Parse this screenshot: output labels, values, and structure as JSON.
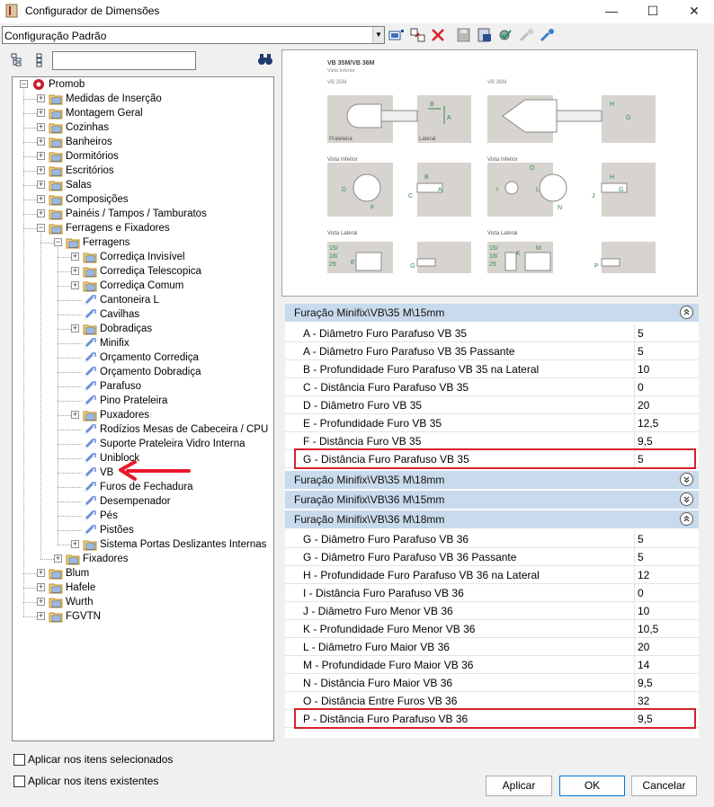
{
  "window": {
    "title": "Configurador de Dimensões",
    "minimize": "—",
    "maximize": "☐",
    "close": "✕"
  },
  "toolbar": {
    "config_value": "Configuração Padrão"
  },
  "tree": {
    "search_value": "",
    "items": [
      {
        "label": "Promob",
        "level": 0,
        "expand": "-",
        "icon": "promob"
      },
      {
        "label": "Medidas de Inserção",
        "level": 1,
        "expand": "+",
        "icon": "folder"
      },
      {
        "label": "Montagem Geral",
        "level": 1,
        "expand": "+",
        "icon": "folder"
      },
      {
        "label": "Cozinhas",
        "level": 1,
        "expand": "+",
        "icon": "folder"
      },
      {
        "label": "Banheiros",
        "level": 1,
        "expand": "+",
        "icon": "folder"
      },
      {
        "label": "Dormitórios",
        "level": 1,
        "expand": "+",
        "icon": "folder"
      },
      {
        "label": "Escritórios",
        "level": 1,
        "expand": "+",
        "icon": "folder"
      },
      {
        "label": "Salas",
        "level": 1,
        "expand": "+",
        "icon": "folder"
      },
      {
        "label": "Composições",
        "level": 1,
        "expand": "+",
        "icon": "folder"
      },
      {
        "label": "Painéis / Tampos / Tamburatos",
        "level": 1,
        "expand": "+",
        "icon": "folder"
      },
      {
        "label": "Ferragens e Fixadores",
        "level": 1,
        "expand": "-",
        "icon": "folder"
      },
      {
        "label": "Ferragens",
        "level": 2,
        "expand": "-",
        "icon": "folder"
      },
      {
        "label": "Corrediça Invisível",
        "level": 3,
        "expand": "+",
        "icon": "folder"
      },
      {
        "label": "Corrediça Telescopica",
        "level": 3,
        "expand": "+",
        "icon": "folder"
      },
      {
        "label": "Corrediça Comum",
        "level": 3,
        "expand": "+",
        "icon": "folder"
      },
      {
        "label": "Cantoneira L",
        "level": 3,
        "expand": "",
        "icon": "tool"
      },
      {
        "label": "Cavilhas",
        "level": 3,
        "expand": "",
        "icon": "tool"
      },
      {
        "label": "Dobradiças",
        "level": 3,
        "expand": "+",
        "icon": "folder"
      },
      {
        "label": "Minifix",
        "level": 3,
        "expand": "",
        "icon": "tool"
      },
      {
        "label": "Orçamento Corrediça",
        "level": 3,
        "expand": "",
        "icon": "tool"
      },
      {
        "label": "Orçamento Dobradiça",
        "level": 3,
        "expand": "",
        "icon": "tool"
      },
      {
        "label": "Parafuso",
        "level": 3,
        "expand": "",
        "icon": "tool"
      },
      {
        "label": "Pino Prateleira",
        "level": 3,
        "expand": "",
        "icon": "tool"
      },
      {
        "label": "Puxadores",
        "level": 3,
        "expand": "+",
        "icon": "folder"
      },
      {
        "label": "Rodízios Mesas de Cabeceira / CPU",
        "level": 3,
        "expand": "",
        "icon": "tool"
      },
      {
        "label": "Suporte Prateleira Vidro Interna",
        "level": 3,
        "expand": "",
        "icon": "tool"
      },
      {
        "label": "Uniblock",
        "level": 3,
        "expand": "",
        "icon": "tool"
      },
      {
        "label": "VB",
        "level": 3,
        "expand": "",
        "icon": "tool"
      },
      {
        "label": "Furos de Fechadura",
        "level": 3,
        "expand": "",
        "icon": "tool"
      },
      {
        "label": "Desempenador",
        "level": 3,
        "expand": "",
        "icon": "tool"
      },
      {
        "label": "Pés",
        "level": 3,
        "expand": "",
        "icon": "tool"
      },
      {
        "label": "Pistões",
        "level": 3,
        "expand": "",
        "icon": "tool"
      },
      {
        "label": "Sistema Portas Deslizantes Internas",
        "level": 3,
        "expand": "+",
        "icon": "folder"
      },
      {
        "label": "Fixadores",
        "level": 2,
        "expand": "+",
        "icon": "folder"
      },
      {
        "label": "Blum",
        "level": 1,
        "expand": "+",
        "icon": "folder"
      },
      {
        "label": "Hafele",
        "level": 1,
        "expand": "+",
        "icon": "folder"
      },
      {
        "label": "Wurth",
        "level": 1,
        "expand": "+",
        "icon": "folder"
      },
      {
        "label": "FGVTN",
        "level": 1,
        "expand": "+",
        "icon": "folder"
      }
    ]
  },
  "diagram": {
    "heading": "VB 35M/VB 36M",
    "subheading": "Vista Inferior",
    "left_title": "VB 35M",
    "right_title": "VB 36M",
    "vista_inferior": "Vista Inferior",
    "vista_lateral": "Vista Lateral",
    "prateleira": "Prateleira",
    "lateral": "Lateral",
    "thickness": [
      "15/",
      "18/",
      "25"
    ],
    "letters": {
      "a": "A",
      "b": "B",
      "c": "C",
      "d": "D",
      "e": "E",
      "f": "F",
      "g": "G",
      "h": "H",
      "i": "I",
      "j": "J",
      "k": "K",
      "l": "L",
      "m": "M",
      "n": "N",
      "o": "O",
      "p": "P"
    }
  },
  "groups": [
    {
      "title": "Furação Minifix\\VB\\35 M\\15mm",
      "expanded": true,
      "glyph": "⌃",
      "rows": [
        {
          "name": "A - Diâmetro Furo Parafuso VB 35",
          "value": "5"
        },
        {
          "name": "A - Diâmetro Furo Parafuso VB 35 Passante",
          "value": "5"
        },
        {
          "name": "B - Profundidade Furo Parafuso VB 35 na Lateral",
          "value": "10"
        },
        {
          "name": "C - Distância Furo Parafuso VB 35",
          "value": "0"
        },
        {
          "name": "D - Diâmetro Furo VB 35",
          "value": "20"
        },
        {
          "name": "E - Profundidade Furo VB 35",
          "value": "12,5"
        },
        {
          "name": "F - Distância Furo VB 35",
          "value": "9,5"
        },
        {
          "name": "G - Distância Furo Parafuso VB 35",
          "value": "5"
        }
      ]
    },
    {
      "title": "Furação Minifix\\VB\\35 M\\18mm",
      "expanded": false,
      "glyph": "⌄",
      "rows": []
    },
    {
      "title": "Furação Minifix\\VB\\36 M\\15mm",
      "expanded": false,
      "glyph": "⌄",
      "rows": []
    },
    {
      "title": "Furação Minifix\\VB\\36 M\\18mm",
      "expanded": true,
      "glyph": "⌃",
      "rows": [
        {
          "name": "G - Diâmetro Furo Parafuso VB 36",
          "value": "5"
        },
        {
          "name": "G - Diâmetro Furo Parafuso VB 36 Passante",
          "value": "5"
        },
        {
          "name": "H - Profundidade Furo Parafuso VB 36 na Lateral",
          "value": "12"
        },
        {
          "name": "I - Distância Furo Parafuso VB 36",
          "value": "0"
        },
        {
          "name": "J - Diâmetro Furo Menor VB 36",
          "value": "10"
        },
        {
          "name": "K - Profundidade Furo Menor VB 36",
          "value": "10,5"
        },
        {
          "name": "L - Diâmetro Furo Maior VB 36",
          "value": "20"
        },
        {
          "name": "M - Profundidade Furo Maior VB 36",
          "value": "14"
        },
        {
          "name": "N - Distância Furo Maior VB 36",
          "value": "9,5"
        },
        {
          "name": "O - Distância Entre Furos VB 36",
          "value": "32"
        },
        {
          "name": "P - Distância Furo Parafuso VB 36",
          "value": "9,5"
        }
      ]
    }
  ],
  "options": {
    "apply_selected": "Aplicar nos itens selecionados",
    "apply_existing": "Aplicar nos itens existentes"
  },
  "buttons": {
    "apply": "Aplicar",
    "ok": "OK",
    "cancel": "Cancelar"
  },
  "colors": {
    "group_header": "#c9daed",
    "highlight": "#d8202a",
    "arrow": "#e8182a",
    "diagram_gray": "#d7d4cf",
    "diagram_green": "#2e8b57"
  }
}
